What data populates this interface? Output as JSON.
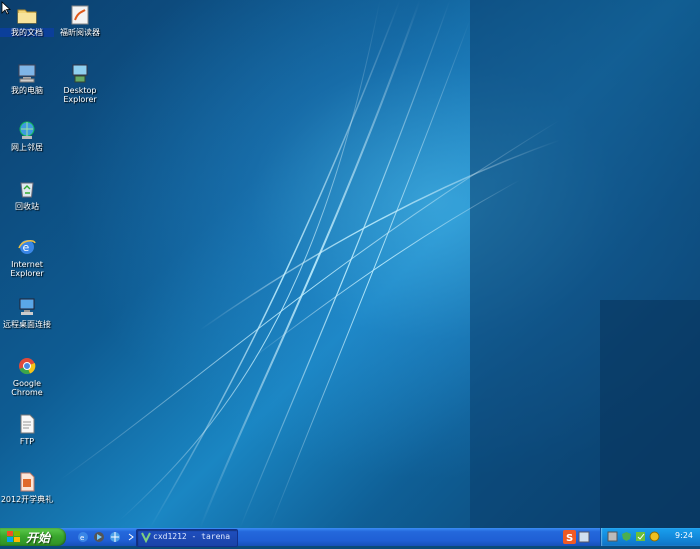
{
  "desktop_icons": [
    {
      "id": "my-documents",
      "label": "我的文档",
      "selected": true
    },
    {
      "id": "reader",
      "label": "福昕阅读器"
    },
    {
      "id": "my-computer",
      "label": "我的电脑"
    },
    {
      "id": "desktop-explorer",
      "label": "Desktop Explorer"
    },
    {
      "id": "network-places",
      "label": "网上邻居"
    },
    {
      "id": "recycle-bin",
      "label": "回收站"
    },
    {
      "id": "internet-explorer",
      "label": "Internet Explorer"
    },
    {
      "id": "remote-desktop",
      "label": "远程桌面连接"
    },
    {
      "id": "google-chrome",
      "label": "Google Chrome"
    },
    {
      "id": "ftp",
      "label": "FTP"
    },
    {
      "id": "new-term-doc",
      "label": "2012开学典礼"
    }
  ],
  "taskbar": {
    "start_label": "开始",
    "task_button_label": "cxd1212 - tarena",
    "clock": "9:24",
    "ime_label": "S"
  },
  "colors": {
    "taskbar": "#2468dc",
    "start": "#3aa82e",
    "tray": "#1286d8"
  }
}
